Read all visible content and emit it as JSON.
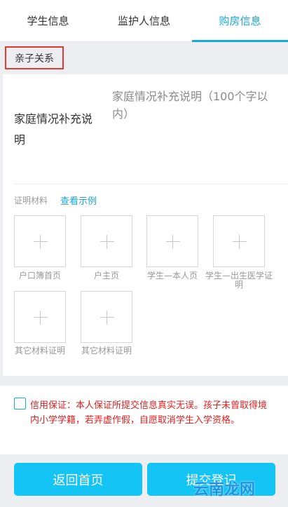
{
  "tabs": [
    {
      "label": "学生信息",
      "active": false
    },
    {
      "label": "监护人信息",
      "active": false
    },
    {
      "label": "购房信息",
      "active": true
    }
  ],
  "section": {
    "tag": "亲子关系"
  },
  "family_note": {
    "label": "家庭情况补充说明",
    "placeholder": "家庭情况补充说明（100个字以内）"
  },
  "materials": {
    "title": "证明材料",
    "example_link": "查看示例",
    "items": [
      {
        "label": "户口簿首页"
      },
      {
        "label": "户主页"
      },
      {
        "label": "学生—本人页"
      },
      {
        "label": "学生—出生医学证明"
      },
      {
        "label": "其它材料证明"
      },
      {
        "label": "其它材料证明"
      }
    ]
  },
  "guarantee": {
    "checked": false,
    "text": "信用保证：本人保证所提交信息真实无误。孩子未曾取得境内小学学籍，若弄虚作假，自愿取消学生入学资格。"
  },
  "buttons": {
    "home": "返回首页",
    "submit": "提交登记"
  },
  "watermark": "云南龙网",
  "colors": {
    "accent": "#1aa7e0",
    "button": "#14c4f5",
    "warning": "#e0201f",
    "highlight_box": "#e53935"
  }
}
